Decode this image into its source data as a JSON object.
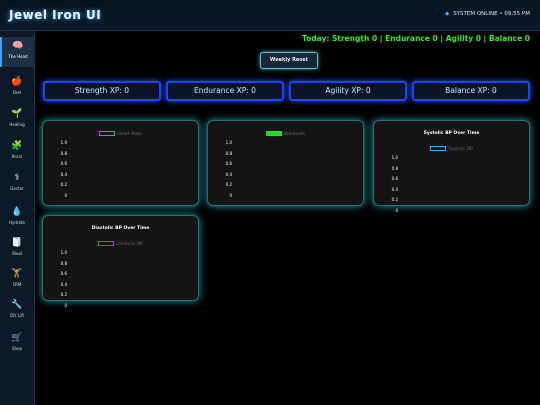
{
  "header": {
    "title": "Jewel Iron UI",
    "status": "SYSTEM ONLINE",
    "time": "09:55 PM"
  },
  "sidebar": {
    "items": [
      {
        "label": "The Head",
        "icon": "brain-icon",
        "glyph": "🧠",
        "active": true
      },
      {
        "label": "Diet",
        "icon": "apple-icon",
        "glyph": "🍎"
      },
      {
        "label": "Healing",
        "icon": "seedling-icon",
        "glyph": "🌱"
      },
      {
        "label": "Brain",
        "icon": "puzzle-icon",
        "glyph": "🧩"
      },
      {
        "label": "Doctor",
        "icon": "caduceus-icon",
        "glyph": "⚕"
      },
      {
        "label": "Hydrate",
        "icon": "droplet-icon",
        "glyph": "💧"
      },
      {
        "label": "Stool",
        "icon": "toilet-paper-icon",
        "glyph": "🧻"
      },
      {
        "label": "1RM",
        "icon": "weightlifter-icon",
        "glyph": "🏋"
      },
      {
        "label": "DIY Lift",
        "icon": "wrench-icon",
        "glyph": "🔧"
      },
      {
        "label": "Shop",
        "icon": "cart-icon",
        "glyph": "🛒"
      }
    ]
  },
  "summary": "Today: Strength 0 | Endurance 0 | Agility 0 | Balance 0",
  "reset_label": "Weekly Reset",
  "xp": [
    "Strength XP: 0",
    "Endurance XP: 0",
    "Agility XP: 0",
    "Balance XP: 0"
  ],
  "chart_data": [
    {
      "type": "line",
      "title": "",
      "series": [
        {
          "name": "Heart Rate",
          "values": []
        }
      ],
      "legend_color": "#22cc22",
      "legend_filled": false,
      "yticks": [
        "1.0",
        "0.8",
        "0.6",
        "0.4",
        "0.2",
        "0"
      ],
      "ylim": [
        0,
        1
      ]
    },
    {
      "type": "bar",
      "title": "",
      "series": [
        {
          "name": "Workouts",
          "values": []
        }
      ],
      "legend_color": "#22dd22",
      "legend_filled": true,
      "yticks": [
        "1.0",
        "0.8",
        "0.6",
        "0.4",
        "0.2",
        "0"
      ],
      "ylim": [
        0,
        1
      ]
    },
    {
      "type": "line",
      "title": "Systolic BP Over Time",
      "series": [
        {
          "name": "Systolic BP",
          "values": []
        }
      ],
      "legend_color": "#22b8d8",
      "legend_filled": false,
      "yticks": [
        "1.0",
        "0.8",
        "0.6",
        "0.4",
        "0.2",
        "0"
      ],
      "ylim": [
        0,
        1
      ]
    },
    {
      "type": "line",
      "title": "Diastolic BP Over Time",
      "series": [
        {
          "name": "Diastolic BP",
          "values": []
        }
      ],
      "legend_color": "#c828c8",
      "legend_filled": false,
      "yticks": [
        "1.0",
        "0.8",
        "0.6",
        "0.4",
        "0.2",
        "0"
      ],
      "ylim": [
        0,
        1
      ]
    }
  ]
}
